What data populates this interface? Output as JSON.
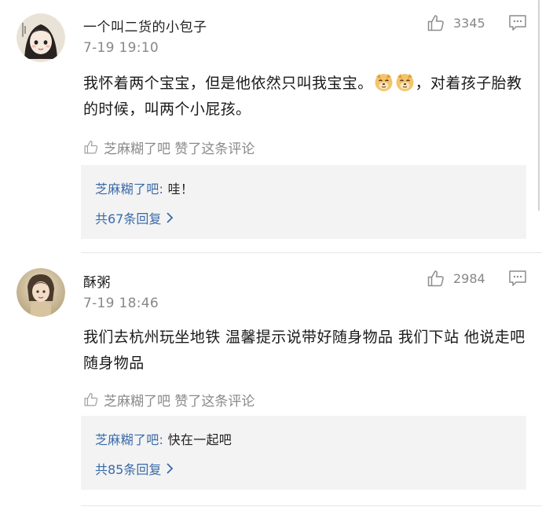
{
  "comments": [
    {
      "username": "一个叫二货的小包子",
      "time": "7-19 19:10",
      "like_count": "3345",
      "text_part1": "我怀着两个宝宝，但是他依然只叫我宝宝。",
      "emoji_icon": "dog-face-emoji",
      "text_part2": "，对着孩子胎教的时候，叫两个小屁孩。",
      "liked_by": "芝麻糊了吧 赞了这条评论",
      "reply": {
        "name": "芝麻糊了吧:",
        "text": "哇！",
        "more": "共67条回复"
      }
    },
    {
      "username": "酥粥",
      "time": "7-19 18:46",
      "like_count": "2984",
      "text": "我们去杭州玩坐地铁 温馨提示说带好随身物品 我们下站 他说走吧随身物品",
      "liked_by": "芝麻糊了吧 赞了这条评论",
      "reply": {
        "name": "芝麻糊了吧:",
        "text": "快在一起吧",
        "more": "共85条回复"
      }
    }
  ],
  "icons": {
    "like": "thumbs-up-icon",
    "reply": "comment-bubble-icon",
    "more": "chevron-right-icon"
  },
  "colors": {
    "link": "#3a6aa8",
    "meta": "#888888",
    "reply_bg": "#f3f3f3"
  }
}
